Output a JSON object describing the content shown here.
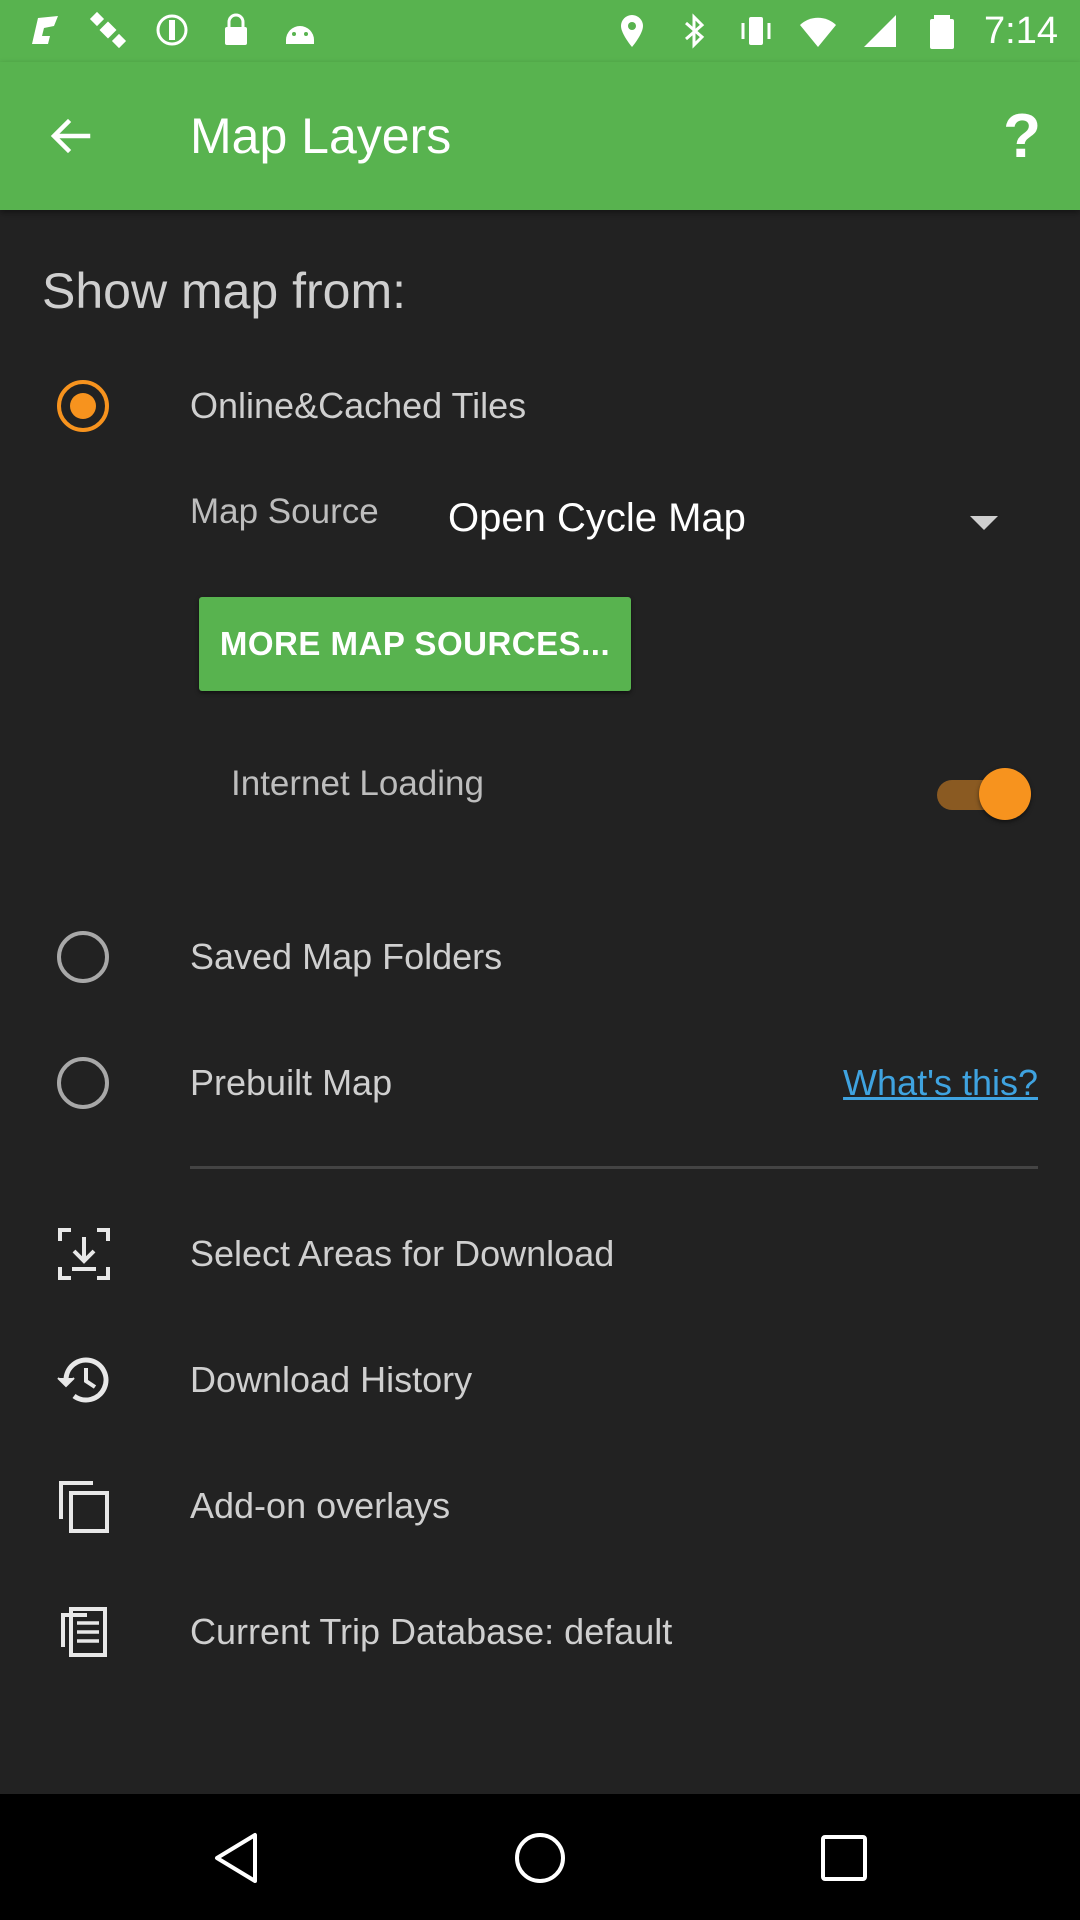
{
  "status_bar": {
    "time": "7:14",
    "left_icons": [
      "fake-gps-icon",
      "satellite-icon",
      "sync-icon",
      "lock-icon",
      "android-icon"
    ],
    "right_icons": [
      "location-icon",
      "bluetooth-icon",
      "vibrate-icon",
      "wifi-icon",
      "cell-signal-icon",
      "battery-icon"
    ]
  },
  "app_bar": {
    "title": "Map Layers",
    "help_label": "?",
    "back_icon": "back-arrow-icon"
  },
  "main": {
    "section_title": "Show map from:",
    "online": {
      "label": "Online&Cached Tiles",
      "selected": true,
      "map_source_label": "Map Source",
      "map_source_value": "Open Cycle Map",
      "more_button": "MORE MAP SOURCES...",
      "internet_loading_label": "Internet Loading",
      "internet_loading_on": true
    },
    "saved": {
      "label": "Saved Map Folders",
      "selected": false
    },
    "prebuilt": {
      "label": "Prebuilt Map",
      "selected": false,
      "help_link": "What's this?"
    },
    "actions": [
      {
        "label": "Select Areas for Download",
        "icon": "download-area-icon"
      },
      {
        "label": "Download History",
        "icon": "history-icon"
      },
      {
        "label": "Add-on overlays",
        "icon": "layers-copy-icon"
      },
      {
        "label": "Current Trip Database: default",
        "icon": "database-icon"
      }
    ]
  },
  "nav_bar": {
    "buttons": [
      "back-nav-icon",
      "home-nav-icon",
      "recents-nav-icon"
    ]
  },
  "colors": {
    "primary_green": "#58b34f",
    "accent_orange": "#f7931e",
    "background": "#222222",
    "link_blue": "#3fa3e0"
  }
}
